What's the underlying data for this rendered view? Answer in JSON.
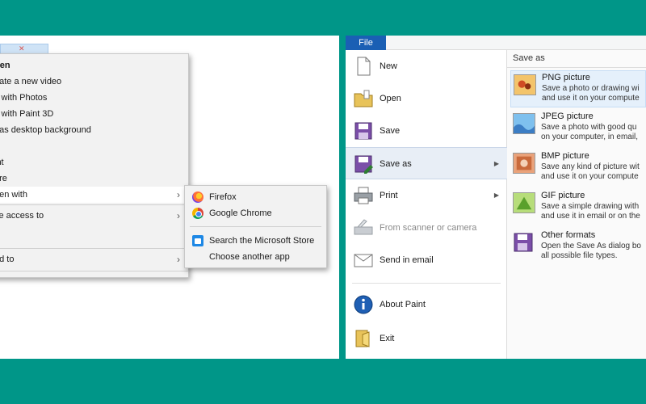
{
  "context_menu": {
    "items": [
      {
        "label": "pen"
      },
      {
        "label": "eate a new video"
      },
      {
        "label": "it with Photos"
      },
      {
        "label": "it with Paint 3D"
      },
      {
        "label": "t as desktop background"
      },
      {
        "label": "it"
      },
      {
        "label": "int"
      },
      {
        "label": "are"
      },
      {
        "label": "pen with"
      },
      {
        "label": "ve access to"
      },
      {
        "label": "nd to"
      }
    ],
    "submenu_arrow": "›"
  },
  "open_with_submenu": {
    "items": [
      {
        "label": "Firefox",
        "icon": "firefox-icon"
      },
      {
        "label": "Google Chrome",
        "icon": "chrome-icon"
      },
      {
        "label": "Search the Microsoft Store",
        "icon": "microsoft-store-icon"
      },
      {
        "label": "Choose another app",
        "icon": ""
      }
    ]
  },
  "paint_menu": {
    "file_tab": "File",
    "items": [
      {
        "label": "New",
        "icon": "new-document-icon"
      },
      {
        "label": "Open",
        "icon": "open-folder-icon"
      },
      {
        "label": "Save",
        "icon": "save-disk-icon"
      },
      {
        "label": "Save as",
        "icon": "save-as-icon"
      },
      {
        "label": "Print",
        "icon": "printer-icon"
      },
      {
        "label": "From scanner or camera",
        "icon": "scanner-icon"
      },
      {
        "label": "Send in email",
        "icon": "email-icon"
      },
      {
        "label": "About Paint",
        "icon": "info-icon"
      },
      {
        "label": "Exit",
        "icon": "exit-icon"
      }
    ],
    "arrow": "▶"
  },
  "save_as_panel": {
    "heading": "Save as",
    "items": [
      {
        "title": "PNG picture",
        "desc1": "Save a photo or drawing wi",
        "desc2": "and use it on your compute",
        "icon": "png-picture-icon"
      },
      {
        "title": "JPEG picture",
        "desc1": "Save a photo with good qu",
        "desc2": "on your computer, in email,",
        "icon": "jpeg-picture-icon"
      },
      {
        "title": "BMP picture",
        "desc1": "Save any kind of picture wit",
        "desc2": "and use it on your compute",
        "icon": "bmp-picture-icon"
      },
      {
        "title": "GIF picture",
        "desc1": "Save a simple drawing with",
        "desc2": "and use it in email or on the",
        "icon": "gif-picture-icon"
      },
      {
        "title": "Other formats",
        "desc1": "Open the Save As dialog bo",
        "desc2": "all possible file types.",
        "icon": "other-formats-icon"
      }
    ]
  },
  "colors": {
    "background": "#009688",
    "file_tab": "#1a5fb4",
    "menu_selected": "#e8eef6",
    "save_as_selected": "#e5f0fb"
  }
}
